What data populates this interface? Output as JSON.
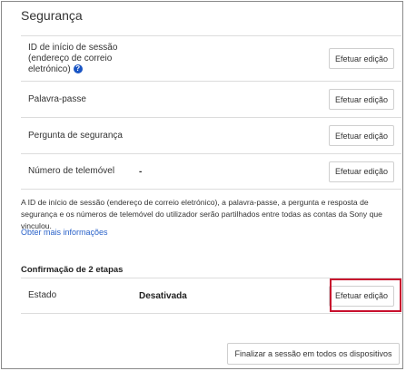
{
  "section": {
    "title": "Segurança"
  },
  "security_rows": [
    {
      "label": "ID de início de sessão (endereço de correio eletrónico)",
      "value": "",
      "button": "Efetuar edição"
    },
    {
      "label": "Palavra-passe",
      "value": "",
      "button": "Efetuar edição"
    },
    {
      "label": "Pergunta de segurança",
      "value": "",
      "button": "Efetuar edição"
    },
    {
      "label": "Número de telemóvel",
      "value": "-",
      "button": "Efetuar edição"
    }
  ],
  "help_icon_glyph": "?",
  "note": "A ID de início de sessão (endereço de correio eletrónico), a palavra-passe, a pergunta e resposta de segurança e os números de telemóvel do utilizador serão partilhados entre todas as contas da Sony que vinculou.",
  "more_info_link": "Obter mais informações",
  "two_step": {
    "title": "Confirmação de 2 etapas",
    "label": "Estado",
    "value": "Desativada",
    "button": "Efetuar edição"
  },
  "signout_all_button": "Finalizar a sessão em todos os dispositivos",
  "colors": {
    "link": "#2a62c9",
    "highlight": "#c8102e",
    "help_icon": "#1a55c4"
  }
}
